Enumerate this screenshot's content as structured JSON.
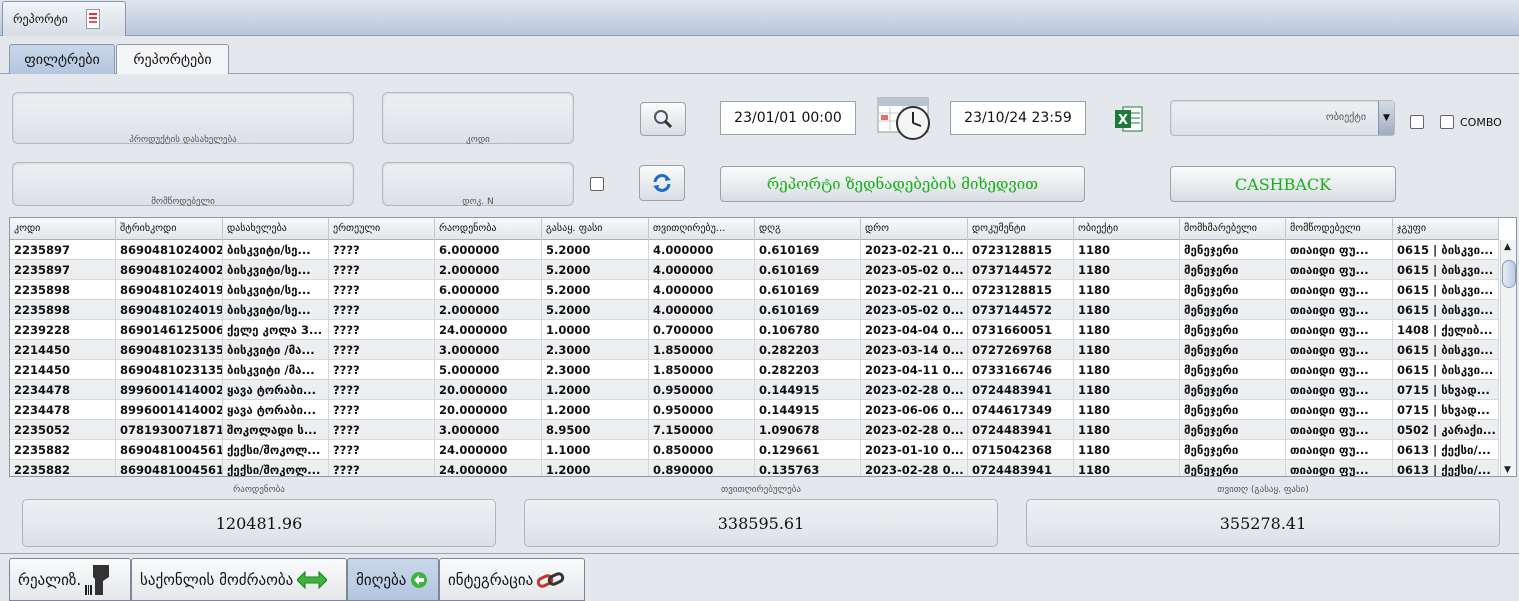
{
  "top_tab": {
    "label": "რეპორტი"
  },
  "subtabs": [
    {
      "label": "ფილტრები"
    },
    {
      "label": "რეპორტები"
    }
  ],
  "filters": {
    "product_name_label": "პროდუქტის დასახელება",
    "code_label": "კოდი",
    "supplier_label": "მომწოდებელი",
    "doc_no_label": "დოკ. N",
    "date_from": "23/01/01 00:00",
    "date_to": "23/10/24 23:59",
    "object_placeholder": "ობიექტი",
    "combo_label": "COMBO",
    "report_button": "რეპორტი ზედნადებების მიხედვით",
    "cashback_button": "CASHBACK"
  },
  "table": {
    "columns": [
      "კოდი",
      "შტრიხკოდი",
      "დასახელება",
      "ერთეული",
      "რაოდენობა",
      "გასაყ. ფასი",
      "თვითღირებუ...",
      "დღგ",
      "დრო",
      "დოკუმენტი",
      "ობიექტი",
      "მომხმარებელი",
      "მომწოდებელი",
      "ჯგუფი"
    ],
    "rows": [
      [
        "2235897",
        "8690481024002",
        "ბისკვიტი/სე...",
        "????",
        "6.000000",
        "5.2000",
        "4.000000",
        "0.610169",
        "2023-02-21 0...",
        "0723128815",
        "1180",
        "მენეჯერი",
        "თიაიდი ფუ...",
        "0615 | ბისკვი..."
      ],
      [
        "2235897",
        "8690481024002",
        "ბისკვიტი/სე...",
        "????",
        "2.000000",
        "5.2000",
        "4.000000",
        "0.610169",
        "2023-05-02 0...",
        "0737144572",
        "1180",
        "მენეჯერი",
        "თიაიდი ფუ...",
        "0615 | ბისკვი..."
      ],
      [
        "2235898",
        "8690481024019",
        "ბისკვიტი/სე...",
        "????",
        "6.000000",
        "5.2000",
        "4.000000",
        "0.610169",
        "2023-02-21 0...",
        "0723128815",
        "1180",
        "მენეჯერი",
        "თიაიდი ფუ...",
        "0615 | ბისკვი..."
      ],
      [
        "2235898",
        "8690481024019",
        "ბისკვიტი/სე...",
        "????",
        "2.000000",
        "5.2000",
        "4.000000",
        "0.610169",
        "2023-05-02 0...",
        "0737144572",
        "1180",
        "მენეჯერი",
        "თიაიდი ფუ...",
        "0615 | ბისკვი..."
      ],
      [
        "2239228",
        "8690146125006",
        "ქელე კოლა 3...",
        "????",
        "24.000000",
        "1.0000",
        "0.700000",
        "0.106780",
        "2023-04-04 0...",
        "0731660051",
        "1180",
        "მენეჯერი",
        "თიაიდი ფუ...",
        "1408 | ქელიბ..."
      ],
      [
        "2214450",
        "8690481023135",
        "ბისკვიტი /მა...",
        "????",
        "3.000000",
        "2.3000",
        "1.850000",
        "0.282203",
        "2023-03-14 0...",
        "0727269768",
        "1180",
        "მენეჯერი",
        "თიაიდი ფუ...",
        "0615 | ბისკვი..."
      ],
      [
        "2214450",
        "8690481023135",
        "ბისკვიტი /მა...",
        "????",
        "5.000000",
        "2.3000",
        "1.850000",
        "0.282203",
        "2023-04-11 0...",
        "0733166746",
        "1180",
        "მენეჯერი",
        "თიაიდი ფუ...",
        "0615 | ბისკვი..."
      ],
      [
        "2234478",
        "8996001414002",
        "ყავა ტორაბი...",
        "????",
        "20.000000",
        "1.2000",
        "0.950000",
        "0.144915",
        "2023-02-28 0...",
        "0724483941",
        "1180",
        "მენეჯერი",
        "თიაიდი ფუ...",
        "0715 | სხვად..."
      ],
      [
        "2234478",
        "8996001414002",
        "ყავა ტორაბი...",
        "????",
        "20.000000",
        "1.2000",
        "0.950000",
        "0.144915",
        "2023-06-06 0...",
        "0744617349",
        "1180",
        "მენეჯერი",
        "თიაიდი ფუ...",
        "0715 | სხვად..."
      ],
      [
        "2235052",
        "0781930071871",
        "შოკოლადი ს...",
        "????",
        "3.000000",
        "8.9500",
        "7.150000",
        "1.090678",
        "2023-02-28 0...",
        "0724483941",
        "1180",
        "მენეჯერი",
        "თიაიდი ფუ...",
        "0502 | კარაქი..."
      ],
      [
        "2235882",
        "8690481004561",
        "ქექსი/შოკოლ...",
        "????",
        "24.000000",
        "1.1000",
        "0.850000",
        "0.129661",
        "2023-01-10 0...",
        "0715042368",
        "1180",
        "მენეჯერი",
        "თიაიდი ფუ...",
        "0613 | ქექსი/..."
      ],
      [
        "2235882",
        "8690481004561",
        "ქექსი/შოკოლ...",
        "????",
        "24.000000",
        "1.2000",
        "0.890000",
        "0.135763",
        "2023-02-28 0...",
        "0724483941",
        "1180",
        "მენეჯერი",
        "თიაიდი ფუ...",
        "0613 | ქექსი/..."
      ]
    ]
  },
  "summary": {
    "qty_label": "რაოდენობა",
    "qty_value": "120481.96",
    "cost_label": "თვითღირებულება",
    "cost_value": "338595.61",
    "sum_label": "თვითღ (გასაყ. ფასი)",
    "sum_value": "355278.41"
  },
  "bottom_tabs": [
    {
      "label": "რეალიზ.",
      "icon": "barcode-scanner-icon"
    },
    {
      "label": "საქონლის მოძრაობა",
      "icon": "green-arrows-icon"
    },
    {
      "label": "მიღება",
      "icon": "green-back-arrow-icon"
    },
    {
      "label": "ინტეგრაცია",
      "icon": "chain-link-icon"
    }
  ],
  "colors": {
    "green_text": "#1ab01a",
    "active_tab": "#b3c6e0"
  }
}
